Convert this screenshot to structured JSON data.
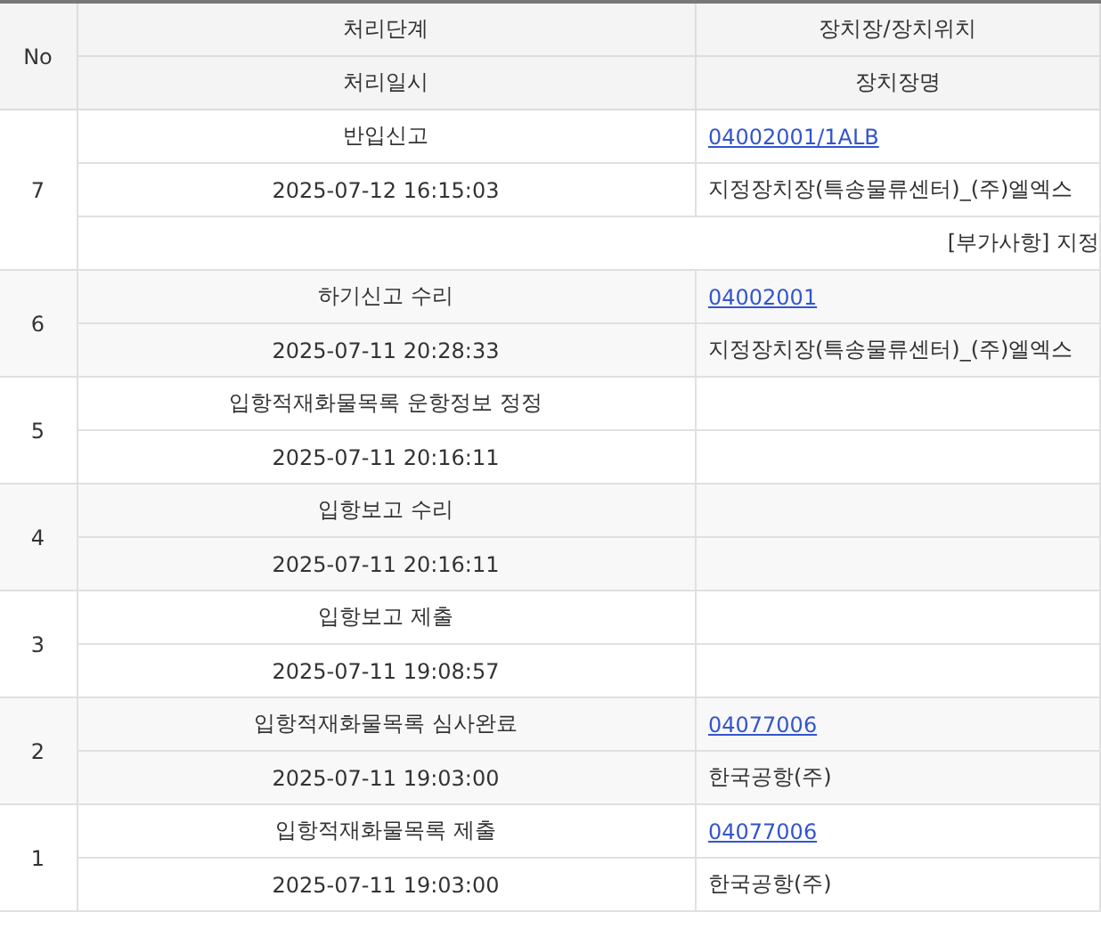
{
  "table": {
    "header": {
      "no": "No",
      "stage": "처리단계",
      "location": "장치장/장치위치",
      "date": "처리일시",
      "location_name": "장치장명"
    },
    "rows": [
      {
        "no": "7",
        "stage": "반입신고",
        "location_code": "04002001/1ALB",
        "date": "2025-07-12 16:15:03",
        "location_name": "지정장치장(특송물류센터)_(주)엘엑스",
        "note": "[부가사항] 지정"
      },
      {
        "no": "6",
        "stage": "하기신고 수리",
        "location_code": "04002001",
        "date": "2025-07-11 20:28:33",
        "location_name": "지정장치장(특송물류센터)_(주)엘엑스"
      },
      {
        "no": "5",
        "stage": "입항적재화물목록 운항정보 정정",
        "date": "2025-07-11 20:16:11"
      },
      {
        "no": "4",
        "stage": "입항보고 수리",
        "date": "2025-07-11 20:16:11"
      },
      {
        "no": "3",
        "stage": "입항보고 제출",
        "date": "2025-07-11 19:08:57"
      },
      {
        "no": "2",
        "stage": "입항적재화물목록 심사완료",
        "location_code": "04077006",
        "date": "2025-07-11 19:03:00",
        "location_name": "한국공항(주)"
      },
      {
        "no": "1",
        "stage": "입항적재화물목록 제출",
        "location_code": "04077006",
        "date": "2025-07-11 19:03:00",
        "location_name": "한국공항(주)"
      }
    ]
  }
}
